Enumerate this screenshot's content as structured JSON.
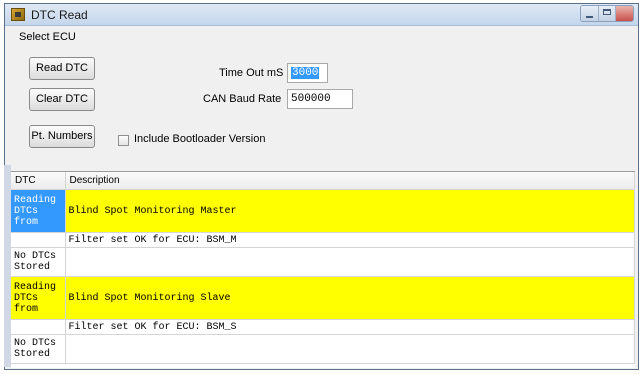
{
  "window": {
    "title": "DTC Read"
  },
  "menu": {
    "select_ecu": "Select ECU"
  },
  "buttons": {
    "read_dtc": "Read DTC",
    "clear_dtc": "Clear DTC",
    "pt_numbers": "Pt. Numbers"
  },
  "fields": {
    "timeout_label": "Time Out mS",
    "timeout_value": "3000",
    "baud_label": "CAN Baud Rate",
    "baud_value": "500000"
  },
  "options": {
    "include_bootloader_label": "Include Bootloader Version",
    "include_bootloader_checked": false
  },
  "table": {
    "headers": [
      "DTC",
      "Description"
    ],
    "rows": [
      {
        "dtc": "Reading DTCs from",
        "description": "Blind Spot Monitoring Master",
        "highlight": true,
        "selected": true
      },
      {
        "dtc": "",
        "description": "Filter set OK for ECU: BSM_M",
        "highlight": false,
        "selected": false
      },
      {
        "dtc": "No DTCs Stored",
        "description": "",
        "highlight": false,
        "selected": false
      },
      {
        "dtc": "Reading DTCs from",
        "description": "Blind Spot Monitoring Slave",
        "highlight": true,
        "selected": false
      },
      {
        "dtc": "",
        "description": "Filter set OK for ECU: BSM_S",
        "highlight": false,
        "selected": false
      },
      {
        "dtc": "No DTCs Stored",
        "description": "",
        "highlight": false,
        "selected": false
      }
    ]
  },
  "colors": {
    "highlight": "#ffff00",
    "selection": "#3399ff"
  }
}
